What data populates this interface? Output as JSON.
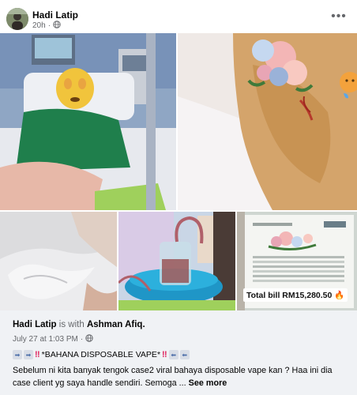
{
  "post": {
    "author": "Hadi Latip",
    "time_ago": "20h",
    "privacy_icon": "globe-icon",
    "more_icon": "ellipsis-icon"
  },
  "gallery": {
    "bill_label": "Total bill RM15,280.50",
    "bill_emoji": "fire-emoji"
  },
  "caption": {
    "author": "Hadi Latip",
    "with_text": "is with",
    "tagged": "Ashman Afiq.",
    "date": "July 27 at 1:03 PM",
    "headline": "*BAHANA DISPOSABLE VAPE*",
    "body": "Sebelum ni kita banyak tengok case2 viral bahaya disposable vape kan ? Haa ini dia case client yg saya handle sendiri. Semoga ...",
    "see_more": "See more"
  },
  "colors": {
    "meta_text": "#65676b",
    "footer_bg": "#f0f2f5",
    "accent_red": "#e0245e"
  }
}
